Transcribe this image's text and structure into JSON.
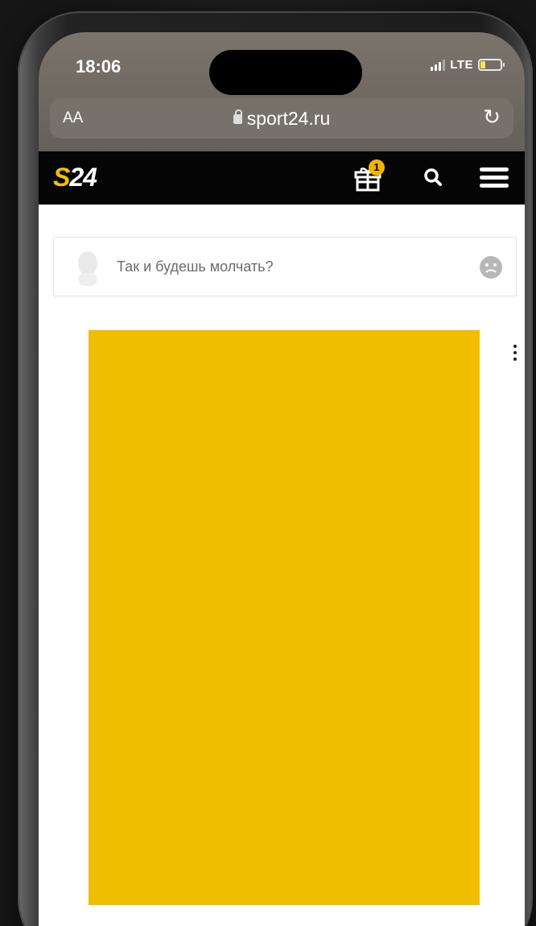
{
  "status_bar": {
    "time": "18:06",
    "network": "LTE"
  },
  "browser": {
    "aa_label": "AA",
    "url": "sport24.ru",
    "icons": [
      "lock-icon",
      "reload-icon"
    ]
  },
  "site_header": {
    "logo_s": "S",
    "logo_rest": "24",
    "gift_badge": "1",
    "icons": [
      "gift-icon",
      "search-icon",
      "menu-icon"
    ]
  },
  "comment": {
    "placeholder": "Так и будешь молчать?",
    "icons": [
      "avatar-icon",
      "emoji-icon"
    ]
  },
  "ad": {
    "color": "#f0bd00"
  },
  "colors": {
    "brand_yellow": "#f2c200",
    "header_bg": "#050505"
  }
}
